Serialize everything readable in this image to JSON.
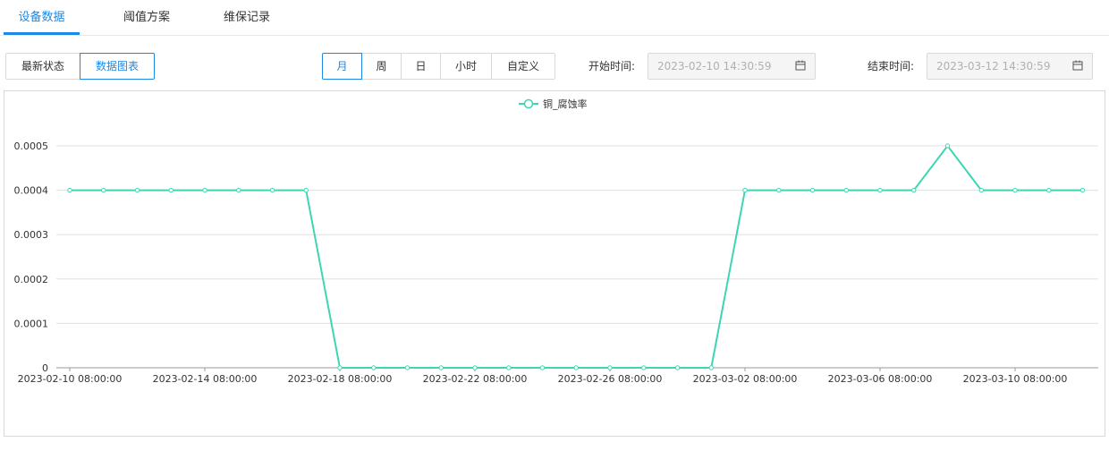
{
  "tabs": [
    {
      "label": "设备数据",
      "active": true
    },
    {
      "label": "阈值方案",
      "active": false
    },
    {
      "label": "维保记录",
      "active": false
    }
  ],
  "view_toggle": {
    "items": [
      "最新状态",
      "数据图表"
    ],
    "active_index": 1
  },
  "period": {
    "items": [
      "月",
      "周",
      "日",
      "小时",
      "自定义"
    ],
    "active_index": 0
  },
  "start": {
    "label": "开始时间:",
    "value": "2023-02-10 14:30:59"
  },
  "end": {
    "label": "结束时间:",
    "value": "2023-03-12 14:30:59"
  },
  "icons": {
    "date_picker": "calendar-icon"
  },
  "colors": {
    "accent": "#1e88e5",
    "series": "#3dd6b3"
  },
  "chart_data": {
    "type": "line",
    "title": "",
    "legend_position": "top-center",
    "grid": true,
    "ylim": [
      0,
      0.0005
    ],
    "yticks": [
      "0",
      "0.0001",
      "0.0002",
      "0.0003",
      "0.0004",
      "0.0005"
    ],
    "xtick_labels": [
      "2023-02-10 08:00:00",
      "2023-02-14 08:00:00",
      "2023-02-18 08:00:00",
      "2023-02-22 08:00:00",
      "2023-02-26 08:00:00",
      "2023-03-02 08:00:00",
      "2023-03-06 08:00:00",
      "2023-03-10 08:00:00"
    ],
    "x": [
      "2023-02-10",
      "2023-02-11",
      "2023-02-12",
      "2023-02-13",
      "2023-02-14",
      "2023-02-15",
      "2023-02-16",
      "2023-02-17",
      "2023-02-18",
      "2023-02-19",
      "2023-02-20",
      "2023-02-21",
      "2023-02-22",
      "2023-02-23",
      "2023-02-24",
      "2023-02-25",
      "2023-02-26",
      "2023-02-27",
      "2023-02-28",
      "2023-03-01",
      "2023-03-02",
      "2023-03-03",
      "2023-03-04",
      "2023-03-05",
      "2023-03-06",
      "2023-03-07",
      "2023-03-08",
      "2023-03-09",
      "2023-03-10",
      "2023-03-11",
      "2023-03-12"
    ],
    "series": [
      {
        "name": "铜_腐蚀率",
        "values": [
          0.0004,
          0.0004,
          0.0004,
          0.0004,
          0.0004,
          0.0004,
          0.0004,
          0.0004,
          0,
          0,
          0,
          0,
          0,
          0,
          0,
          0,
          0,
          0,
          0,
          0,
          0.0004,
          0.0004,
          0.0004,
          0.0004,
          0.0004,
          0.0004,
          0.0005,
          0.0004,
          0.0004,
          0.0004,
          0.0004
        ]
      }
    ]
  }
}
